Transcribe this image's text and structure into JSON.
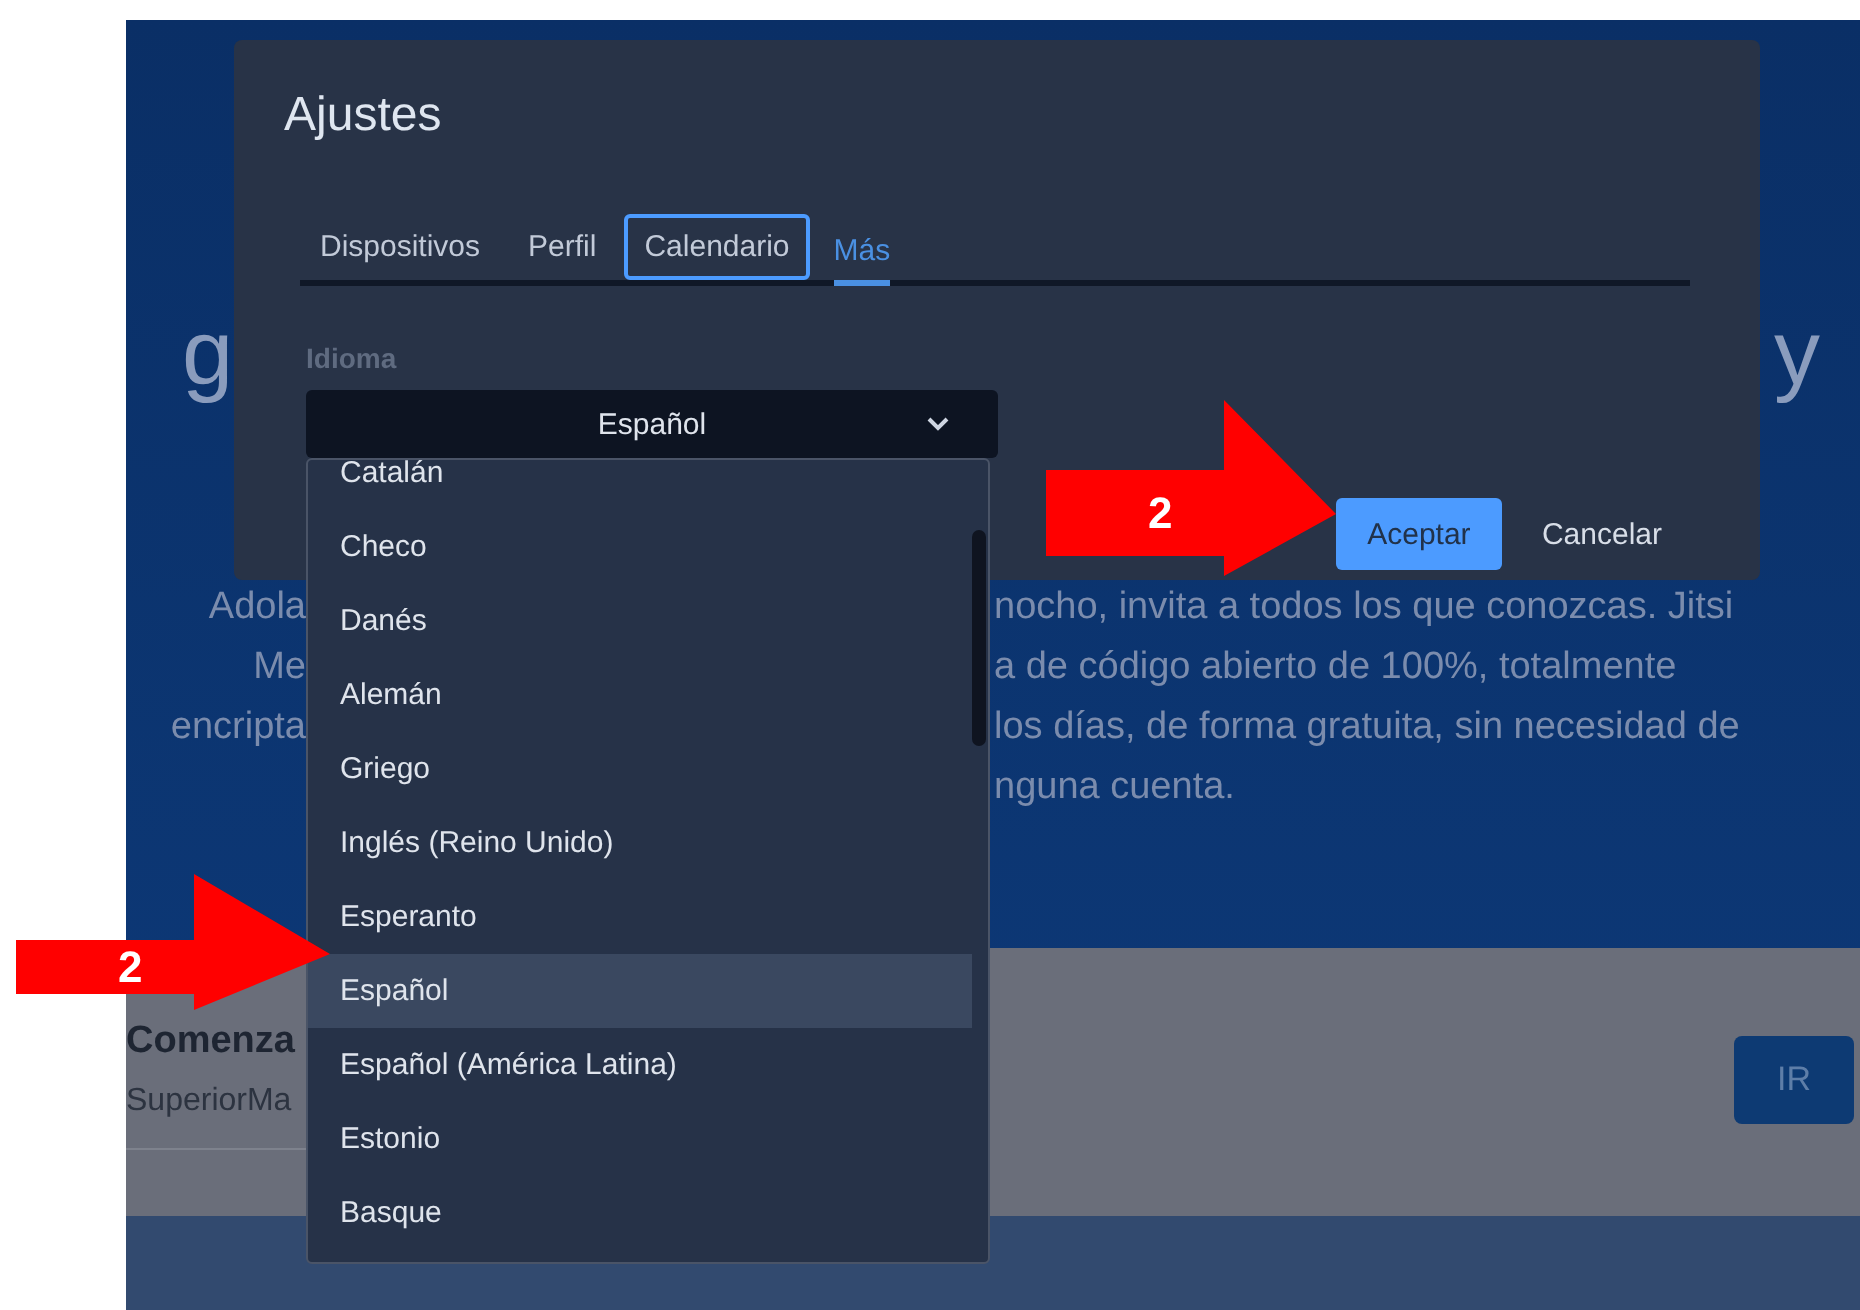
{
  "page": {
    "heading_fragments": [
      "g",
      "y"
    ],
    "paragraph_lines": [
      {
        "left": "Adola",
        "right": "nocho, invita a todos los que conozcas. Jitsi"
      },
      {
        "left": "Me",
        "right": "a de código abierto de 100%, totalmente"
      },
      {
        "left": "encripta",
        "right": "los días, de forma gratuita, sin necesidad de"
      },
      {
        "right": "nguna cuenta."
      }
    ],
    "section": {
      "title": "Comenza",
      "subtitle": "SuperiorMa",
      "button": "IR"
    }
  },
  "dialog": {
    "title": "Ajustes",
    "tabs": [
      {
        "label": "Dispositivos",
        "selected": false,
        "focused": false
      },
      {
        "label": "Perfil",
        "selected": false,
        "focused": false
      },
      {
        "label": "Calendario",
        "selected": false,
        "focused": true
      },
      {
        "label": "Más",
        "selected": true,
        "focused": false
      }
    ],
    "field_label": "Idioma",
    "select_value": "Español",
    "buttons": [
      {
        "label": "Aceptar",
        "kind": "primary"
      },
      {
        "label": "Cancelar",
        "kind": "secondary"
      }
    ]
  },
  "dropdown": {
    "options": [
      {
        "label": "Catalán",
        "selected": false
      },
      {
        "label": "Checo",
        "selected": false
      },
      {
        "label": "Danés",
        "selected": false
      },
      {
        "label": "Alemán",
        "selected": false
      },
      {
        "label": "Griego",
        "selected": false
      },
      {
        "label": "Inglés (Reino Unido)",
        "selected": false
      },
      {
        "label": "Esperanto",
        "selected": false
      },
      {
        "label": "Español",
        "selected": true
      },
      {
        "label": "Español (América Latina)",
        "selected": false
      },
      {
        "label": "Estonio",
        "selected": false
      },
      {
        "label": "Basque",
        "selected": false
      }
    ]
  },
  "annotations": [
    {
      "label": "2"
    },
    {
      "label": "2"
    }
  ]
}
